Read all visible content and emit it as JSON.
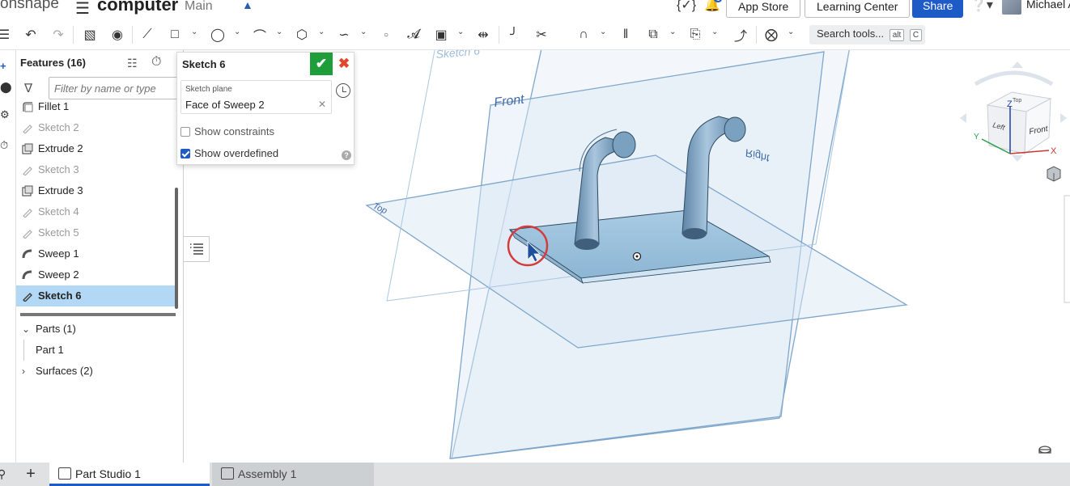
{
  "header": {
    "brand": "onshape",
    "doc_title": "computer",
    "branch": "Main",
    "app_store": "App Store",
    "learning_center": "Learning Center",
    "share": "Share",
    "notification_count": "1",
    "user_name": "Michael A"
  },
  "toolbar": {
    "search_label": "Search tools...",
    "search_kbd1": "alt",
    "search_kbd2": "C"
  },
  "features": {
    "header": "Features (16)",
    "filter_placeholder": "Filter by name or type",
    "items": [
      {
        "label": "Fillet 1",
        "icon": "fillet-icon",
        "state": "normal"
      },
      {
        "label": "Sketch 2",
        "icon": "sketch-icon",
        "state": "dim"
      },
      {
        "label": "Extrude 2",
        "icon": "extrude-icon",
        "state": "normal"
      },
      {
        "label": "Sketch 3",
        "icon": "sketch-icon",
        "state": "dim"
      },
      {
        "label": "Extrude 3",
        "icon": "extrude-icon",
        "state": "normal"
      },
      {
        "label": "Sketch 4",
        "icon": "sketch-icon",
        "state": "dim"
      },
      {
        "label": "Sketch 5",
        "icon": "sketch-icon",
        "state": "dim"
      },
      {
        "label": "Sweep 1",
        "icon": "sweep-icon",
        "state": "normal"
      },
      {
        "label": "Sweep 2",
        "icon": "sweep-icon",
        "state": "normal"
      },
      {
        "label": "Sketch 6",
        "icon": "sketch-icon",
        "state": "selected"
      }
    ],
    "parts_header": "Parts (1)",
    "part_1": "Part 1",
    "surfaces_header": "Surfaces (2)"
  },
  "sketch_dialog": {
    "title": "Sketch 6",
    "plane_label": "Sketch plane",
    "plane_value": "Face of Sweep 2",
    "show_constraints": "Show constraints",
    "show_constraints_checked": false,
    "show_overdefined": "Show overdefined",
    "show_overdefined_checked": true,
    "help": "?"
  },
  "viewport": {
    "plane_labels": {
      "sketch": "Sketch 6",
      "front": "Front",
      "top": "Top",
      "right": "Right"
    },
    "view_cube": {
      "top": "Top",
      "front": "Front",
      "left": "Left",
      "axis_x": "X",
      "axis_y": "Y",
      "axis_z": "Z"
    }
  },
  "tabs": [
    {
      "label": "Part Studio 1",
      "active": true
    },
    {
      "label": "Assembly 1",
      "active": false
    }
  ]
}
